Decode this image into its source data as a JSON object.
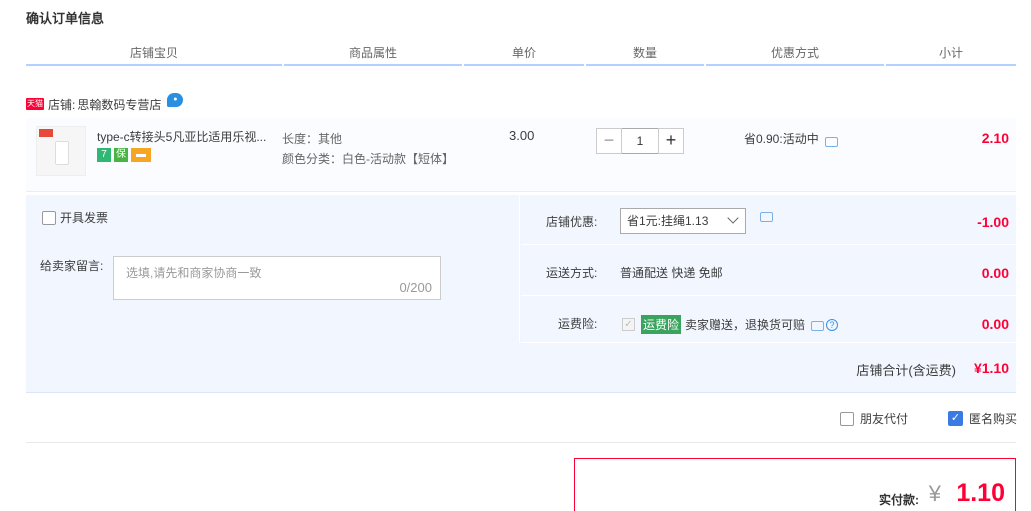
{
  "page": {
    "title": "确认订单信息"
  },
  "table": {
    "headers": [
      "店铺宝贝",
      "商品属性",
      "单价",
      "数量",
      "优惠方式",
      "小计"
    ]
  },
  "shop": {
    "badge": "天猫",
    "label": "店铺:",
    "name": "思翰数码专营店"
  },
  "item": {
    "name": "type-c转接头5凡亚比适用乐视...",
    "badges": [
      "7"
    ],
    "attr_length": "长度：其他",
    "attr_color": "颜色分类：白色-活动款【短体】",
    "price": "3.00",
    "quantity": "1",
    "qty_minus": "−",
    "qty_plus": "+",
    "discount": "省0.90:活动中",
    "subtotal": "2.10"
  },
  "options": {
    "invoice_label": "开具发票",
    "memo_label": "给卖家留言:",
    "memo_placeholder": "选填,请先和商家协商一致",
    "memo_count": "0/200",
    "shop_discount_label": "店铺优惠:",
    "shop_discount_value": "省1元:挂绳1.13",
    "shop_discount_amount": "-1.00",
    "shipping_label": "运送方式:",
    "shipping_value": "普通配送 快递 免邮",
    "shipping_amount": "0.00",
    "insurance_label": "运费险:",
    "insurance_tag": "运费险",
    "insurance_text": "卖家赠送，退换货可赔",
    "insurance_amount": "0.00",
    "total_label": "店铺合计(含运费)",
    "total_amount": "¥1.10"
  },
  "payment": {
    "friend_pay": "朋友代付",
    "anonymous": "匿名购买",
    "anonymous_checked": true
  },
  "final": {
    "label": "实付款:",
    "yen": "¥",
    "amount": "1.10"
  },
  "colors": {
    "accent_red": "#ff0036",
    "header_line": "#b2d1ff",
    "panel_bg": "#f2f7ff",
    "checkbox_blue": "#3a7be3"
  }
}
